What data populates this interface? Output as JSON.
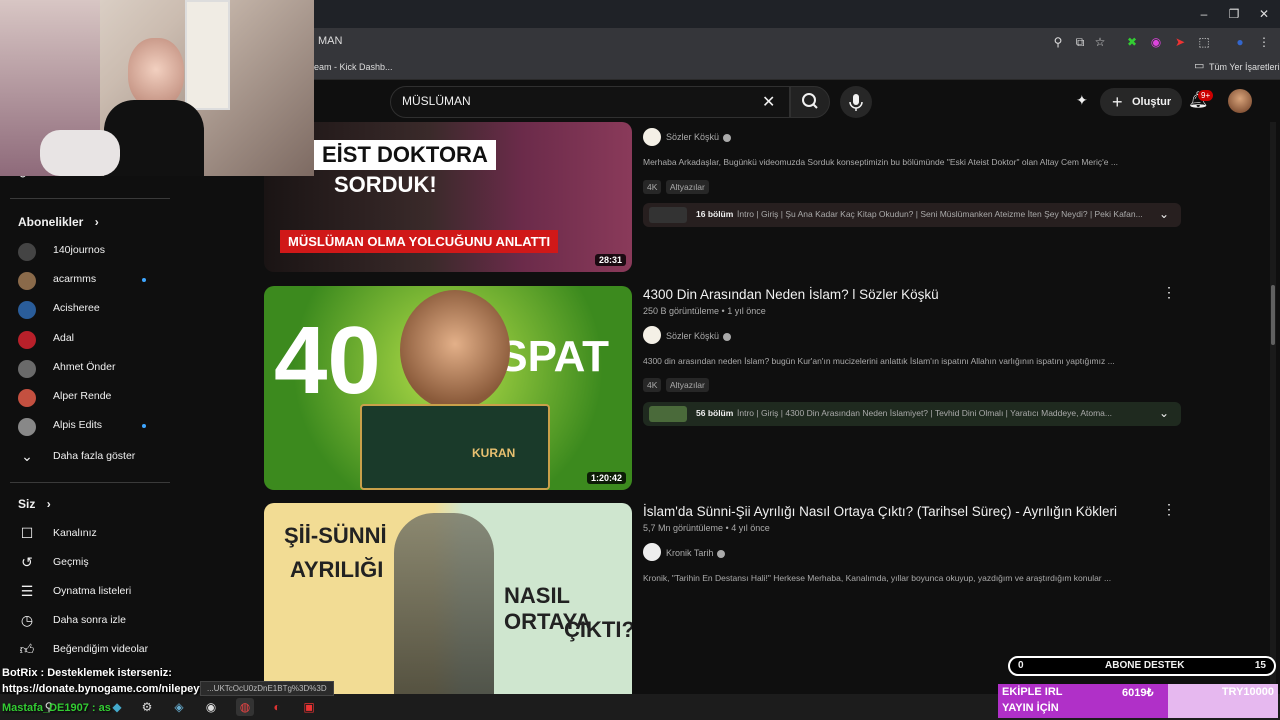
{
  "browser": {
    "url": "MAN",
    "bookmark1": "eam - Kick Dashb...",
    "bookmark_all": "Tüm Yer İşaretleri"
  },
  "search": {
    "query": "MÜSLÜMAN"
  },
  "header": {
    "create_label": "Oluştur",
    "notif_badge": "9+"
  },
  "sidebar": {
    "subscriptions_title": "Abonelikler",
    "subscriptions": [
      {
        "label": "140journos",
        "color": "#444444",
        "new": false
      },
      {
        "label": "acarmms",
        "color": "#8a6a4a",
        "new": true
      },
      {
        "label": "Acisheree",
        "color": "#2a5d9a",
        "new": false
      },
      {
        "label": "Adal",
        "color": "#b8202a",
        "new": false
      },
      {
        "label": "Ahmet Önder",
        "color": "#6a6a6a",
        "new": false
      },
      {
        "label": "Alper Rende",
        "color": "#c45040",
        "new": false
      },
      {
        "label": "Alpis Edits",
        "color": "#888888",
        "new": true
      }
    ],
    "show_more": "Daha fazla göster",
    "you_title": "Siz",
    "you_items": [
      {
        "label": "Kanalınız"
      },
      {
        "label": "Geçmiş"
      },
      {
        "label": "Oynatma listeleri"
      },
      {
        "label": "Daha sonra izle"
      },
      {
        "label": "Beğendiğim videolar"
      }
    ],
    "partial_top": "Shorts"
  },
  "videos": [
    {
      "title": "",
      "thumb_text1": "EİST DOKTORA",
      "thumb_text2": "SORDUK!",
      "thumb_text3": "MÜSLÜMAN OLMA YOLCUĞUNU ANLATTI",
      "duration": "28:31",
      "channel": "Sözler Köşkü",
      "description": "Merhaba Arkadaşlar, Bugünkü videomuzda Sorduk konseptimizin bu bölümünde \"Eski Ateist Doktor\" olan Altay Cem Meriç'e ...",
      "tags": [
        "4K",
        "Altyazılar"
      ],
      "chapters_count": "16 bölüm",
      "chapters_text": "İntro | Giriş | Şu Ana Kadar Kaç Kitap Okudun? | Seni Müslümanken Ateizme İten Şey Neydi? | Peki Kafan..."
    },
    {
      "title": "4300 Din Arasından Neden İslam? l Sözler Köşkü",
      "meta": "250 B görüntüleme • 1 yıl önce",
      "thumb_text1": "40",
      "thumb_text2": "İSPAT",
      "thumb_text3": "KURAN",
      "duration": "1:20:42",
      "channel": "Sözler Köşkü",
      "description": "4300 din arasından neden İslam? bugün Kur'an'ın mucizelerini anlattık İslam'ın ispatını Allahın varlığının ispatını yaptığımız ...",
      "tags": [
        "4K",
        "Altyazılar"
      ],
      "chapters_count": "56 bölüm",
      "chapters_text": "İntro | Giriş | 4300 Din Arasından Neden İslamiyet? | Tevhid Dini Olmalı | Yaratıcı Maddeye, Atoma..."
    },
    {
      "title": "İslam'da Sünni-Şii Ayrılığı Nasıl Ortaya Çıktı? (Tarihsel Süreç) - Ayrılığın Kökleri",
      "meta": "5,7 Mn görüntüleme • 4 yıl önce",
      "thumb_text1": "Şİİ-SÜNNİ",
      "thumb_text2": "AYRILIĞI",
      "thumb_text3": "NASIL ORTAYA",
      "thumb_text4": "ÇIKTI?",
      "channel": "Kronik Tarih",
      "description": "Kronik, \"Tarihin En Destansı Hali!\" Herkese Merhaba, Kanalımda, yıllar boyunca okuyup, yazdığım ve araştırdığım konular ..."
    }
  ],
  "overlay": {
    "chat1": "BotRix : Desteklemek isterseniz:",
    "chat2": "https://donate.bynogame.com/nilepeyy",
    "chat3": "Mastafa_DE1907 : as",
    "link_popup": "...UKTcOcU0zDnE1BTg%3D%3D",
    "abone_left": "0",
    "abone_center": "ABONE DESTEK",
    "abone_right": "15",
    "ekiple1": "EKİPLE IRL",
    "ekiple2": "YAYIN İÇİN",
    "ekiple_amount": "6019₺",
    "goal": "TRY10000"
  }
}
